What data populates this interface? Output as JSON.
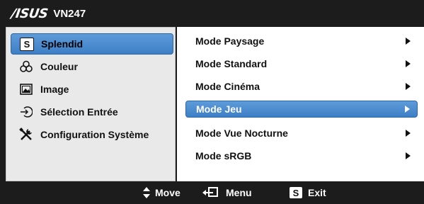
{
  "header": {
    "brand": "/ISUS",
    "model": "VN247"
  },
  "left_menu": {
    "items": [
      {
        "label": "Splendid",
        "icon": "splendid-s-icon",
        "selected": true
      },
      {
        "label": "Couleur",
        "icon": "color-circles-icon",
        "selected": false
      },
      {
        "label": "Image",
        "icon": "picture-icon",
        "selected": false
      },
      {
        "label": "Sélection Entrée",
        "icon": "input-select-icon",
        "selected": false
      },
      {
        "label": "Configuration Système",
        "icon": "tools-icon",
        "selected": false
      }
    ]
  },
  "right_menu": {
    "items": [
      {
        "label": "Mode Paysage",
        "selected": false
      },
      {
        "label": "Mode Standard",
        "selected": false
      },
      {
        "label": "Mode Cinéma",
        "selected": false
      },
      {
        "label": "Mode Jeu",
        "selected": true
      },
      {
        "label": "Mode Vue Nocturne",
        "selected": false
      },
      {
        "label": "Mode sRGB",
        "selected": false
      }
    ]
  },
  "footer": {
    "move_label": "Move",
    "menu_label": "Menu",
    "exit_label": "Exit",
    "exit_key": "S"
  },
  "icon_glyphs": {
    "splendid": "S"
  },
  "colors": {
    "background": "#1c1c1c",
    "highlight": "#4a8bd0",
    "left_panel": "#e9e9e9",
    "right_panel": "#ffffff"
  }
}
